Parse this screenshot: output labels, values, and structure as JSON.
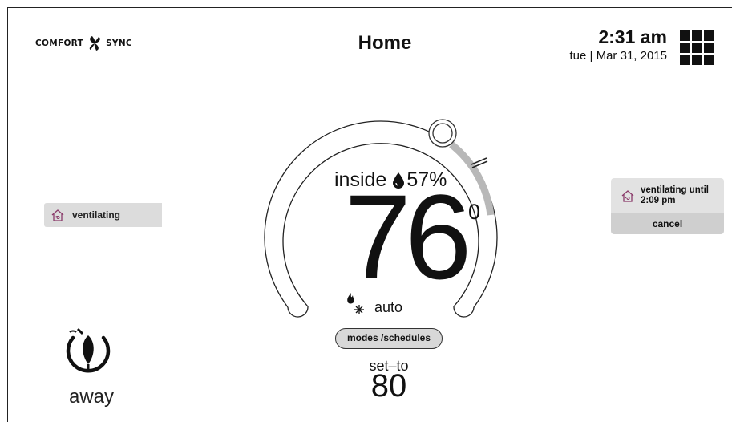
{
  "brand": {
    "left": "COMFORT",
    "right": "SYNC"
  },
  "header": {
    "title": "Home"
  },
  "clock": {
    "time": "2:31 am",
    "date": "tue | Mar 31, 2015"
  },
  "status_left": {
    "label": "ventilating",
    "icon": "ventilation-house-icon"
  },
  "status_right": {
    "label_line1": "ventilating until",
    "label_line2": "2:09 pm",
    "cancel_label": "cancel",
    "icon": "ventilation-house-icon"
  },
  "thermostat": {
    "inside_label": "inside",
    "humidity": "57%",
    "temperature": "76",
    "degree_mark": "0",
    "mode_label": "auto",
    "mode_button": "modes /schedules",
    "setto_label": "set–to",
    "setto_value": "80"
  },
  "away": {
    "label": "away"
  },
  "colors": {
    "ventilation_icon": "#8a3a6a",
    "pill_bg": "#dcdcdc"
  }
}
